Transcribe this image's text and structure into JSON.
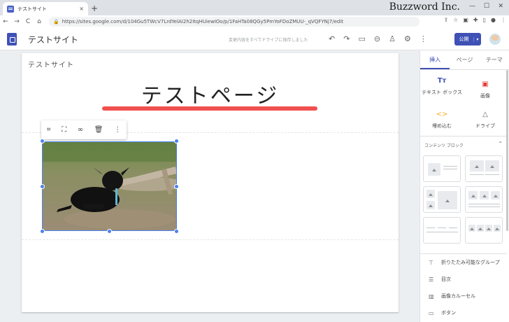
{
  "browser": {
    "tab_title": "テストサイト",
    "tab_close": "×",
    "new_tab": "+",
    "url": "https://sites.google.com/d/104Gu5TWcV7LrdYelAI2h2ItqHUiewIOo/p/1FaHTa08QGy5PmYoFDoZMUU-_qVQFYNj7/edit",
    "watermark": "Buzzword Inc.",
    "nav_back": "←",
    "nav_forward": "→",
    "nav_reload": "C",
    "nav_home": "⌂"
  },
  "sites_toolbar": {
    "site_name": "テストサイト",
    "saved_note": "変更内容をすべてドライブに保存しました",
    "publish_label": "公開",
    "publish_caret": "▾"
  },
  "page": {
    "site_label": "テストサイト",
    "title": "テストページ"
  },
  "panel": {
    "tabs": [
      "挿入",
      "ページ",
      "テーマ"
    ],
    "insert_items": [
      "テキスト ボックス",
      "画像",
      "埋め込む",
      "ドライブ"
    ],
    "content_blocks_label": "コンテンツ ブロック",
    "extra_items": [
      "折りたたみ可能なグループ",
      "目次",
      "画像カルーセル",
      "ボタン"
    ]
  },
  "colors": {
    "accent": "#3f51b5",
    "title_underline": "#f0504f",
    "selection": "#4a82f2"
  }
}
